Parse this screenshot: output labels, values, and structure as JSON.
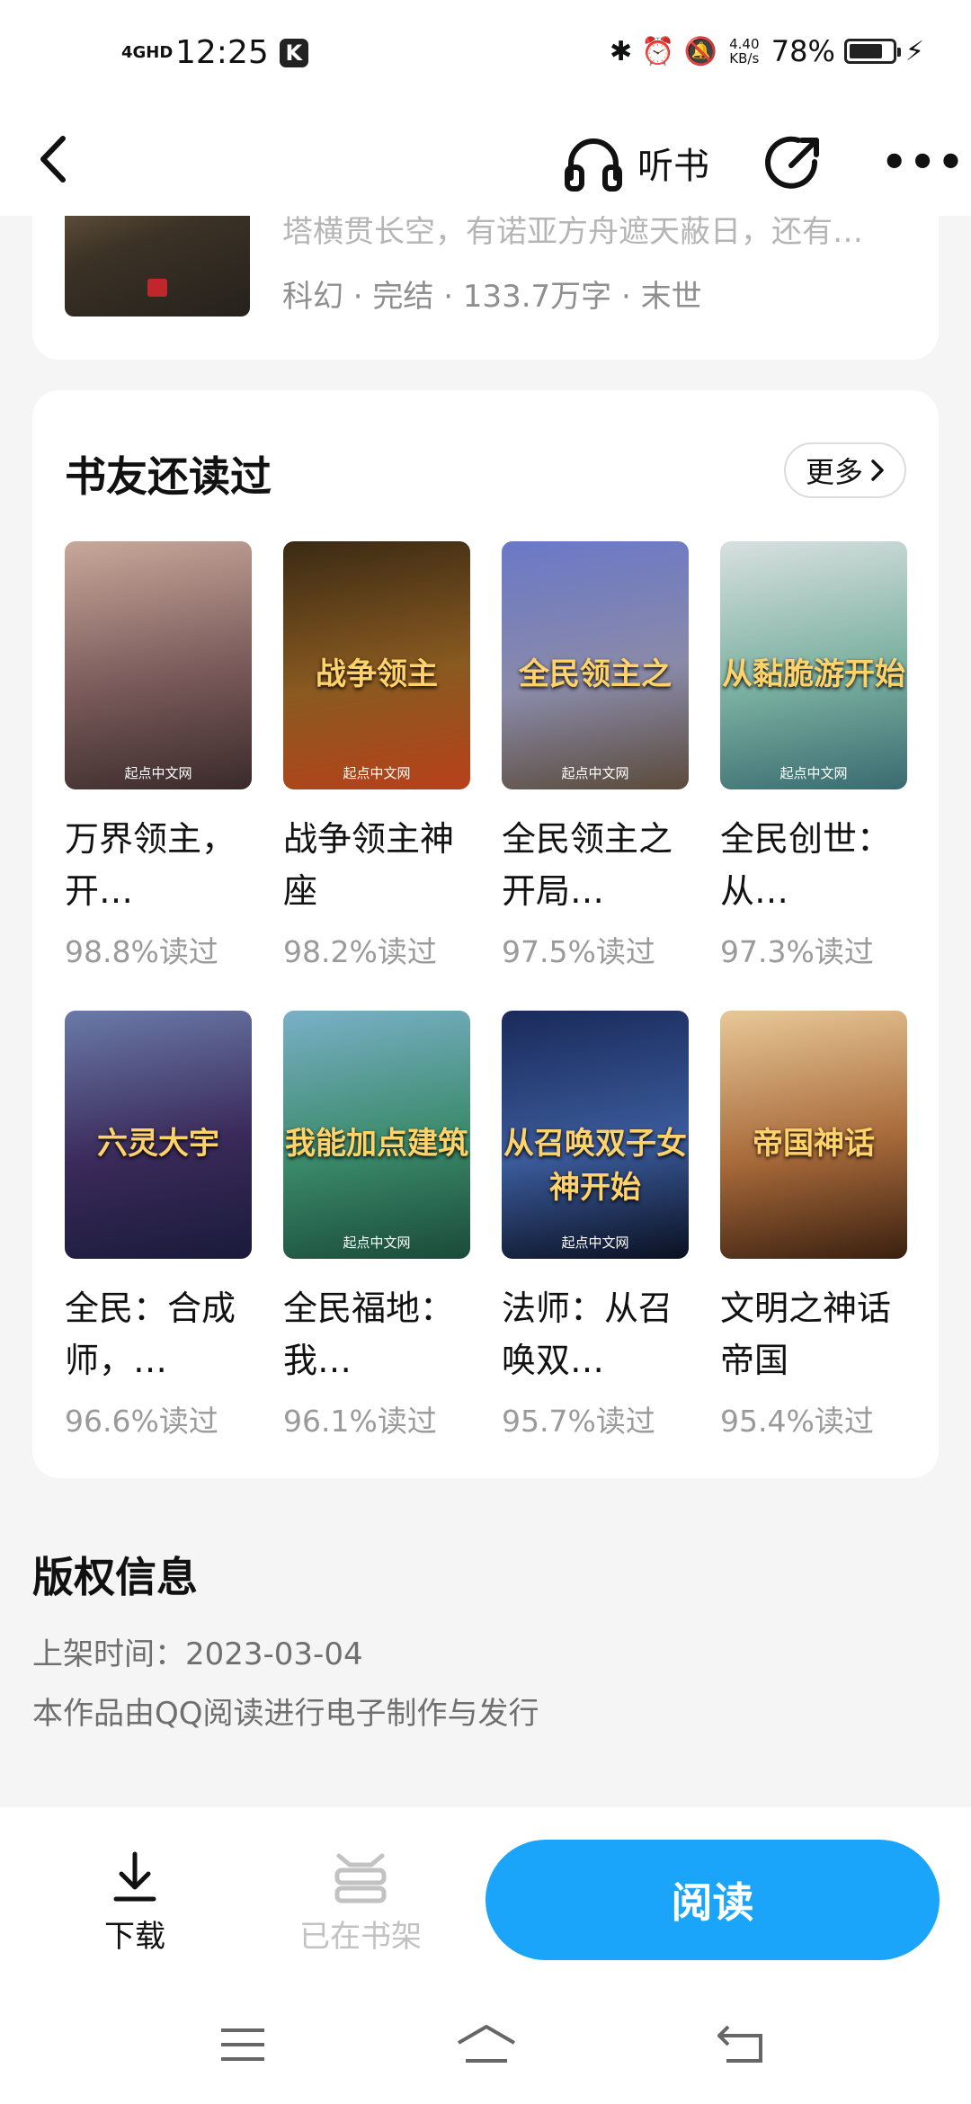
{
  "status_bar": {
    "network": "4GHD",
    "time": "12:25",
    "k_badge": "K",
    "speed": "4.40 KB/s",
    "battery_percent": "78%",
    "battery_level": 0.78
  },
  "top_bar": {
    "listen_label": "听书"
  },
  "prev_book": {
    "description": "塔横贯长空，有诺亚方舟遮天蔽日，还有…",
    "meta": "科幻 · 完结 · 133.7万字 · 末世"
  },
  "recommendations": {
    "title": "书友还读过",
    "more_label": "更多",
    "books": [
      {
        "title": "万界领主，开…",
        "stat": "98.8%读过",
        "cover_text": "",
        "publisher": "起点中文网",
        "colors": [
          "#c8a89a",
          "#7a5a5a",
          "#3a2a2a"
        ]
      },
      {
        "title": "战争领主神座",
        "stat": "98.2%读过",
        "cover_text": "战争领主",
        "publisher": "起点中文网",
        "colors": [
          "#3a2a14",
          "#8a5a20",
          "#b8401a"
        ]
      },
      {
        "title": "全民领主之开局…",
        "stat": "97.5%读过",
        "cover_text": "全民领主之",
        "publisher": "起点中文网",
        "colors": [
          "#6a78c8",
          "#8a8aa8",
          "#5a4a3a"
        ]
      },
      {
        "title": "全民创世：从…",
        "stat": "97.3%读过",
        "cover_text": "从黏脆游开始",
        "publisher": "起点中文网",
        "colors": [
          "#d8e0e0",
          "#7ab0a0",
          "#3a6a70"
        ]
      },
      {
        "title": "全民：合成师，…",
        "stat": "96.6%读过",
        "cover_text": "六灵大宇",
        "publisher": "",
        "colors": [
          "#6a7aa8",
          "#3a2a5a",
          "#1a1a3a"
        ]
      },
      {
        "title": "全民福地：我…",
        "stat": "96.1%读过",
        "cover_text": "我能加点建筑",
        "publisher": "起点中文网",
        "colors": [
          "#7ab0c8",
          "#3a8a6a",
          "#1a4a3a"
        ]
      },
      {
        "title": "法师：从召唤双…",
        "stat": "95.7%读过",
        "cover_text": "从召唤双子女神开始",
        "publisher": "起点中文网",
        "colors": [
          "#1a2a5a",
          "#3a5a9a",
          "#0a1020"
        ]
      },
      {
        "title": "文明之神话帝国",
        "stat": "95.4%读过",
        "cover_text": "帝国神话",
        "publisher": "",
        "colors": [
          "#e8c898",
          "#a86a3a",
          "#3a2010"
        ]
      }
    ]
  },
  "copyright": {
    "title": "版权信息",
    "release": "上架时间：2023-03-04",
    "note": "本作品由QQ阅读进行电子制作与发行"
  },
  "bottom_bar": {
    "download_label": "下载",
    "shelf_label": "已在书架",
    "read_label": "阅读"
  }
}
